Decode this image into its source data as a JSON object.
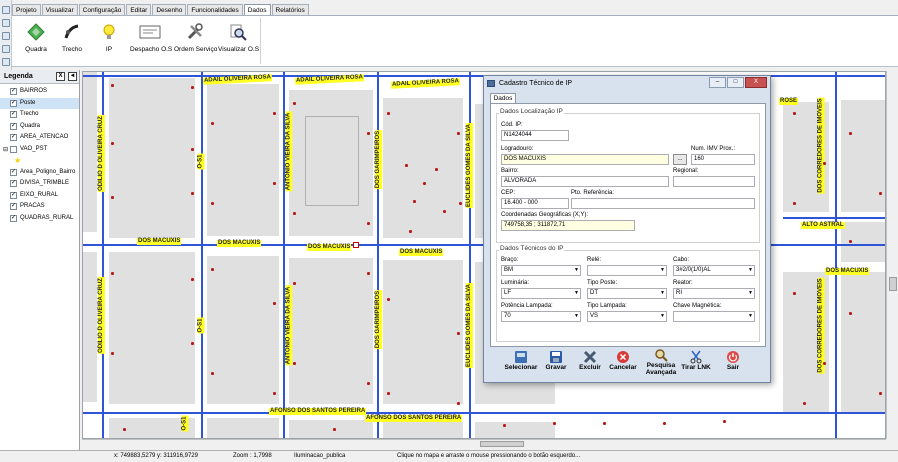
{
  "tabs": [
    "Projeto",
    "Visualizar",
    "Configuração",
    "Editar",
    "Desenho",
    "Funcionalidades",
    "Dados",
    "Relatórios"
  ],
  "active_tab": "Dados",
  "ribbon": {
    "quadra": "Quadra",
    "trecho": "Trecho",
    "ip": "IP",
    "despacho": "Despacho O.S",
    "ordem": "Ordem Serviço",
    "visualizar": "Visualizar O.S"
  },
  "legend": {
    "title": "Legenda",
    "close": "X",
    "pin": "◄",
    "items": [
      {
        "label": "BAIRROS",
        "checked": true
      },
      {
        "label": "Poste",
        "checked": true
      },
      {
        "label": "Trecho",
        "checked": true
      },
      {
        "label": "Quadra",
        "checked": true
      },
      {
        "label": "AREA_ATENCAO",
        "checked": true
      },
      {
        "label": "VAO_PST",
        "checked": false
      },
      {
        "label": "Area_Poligno_Bairro",
        "checked": true
      },
      {
        "label": "DIVISA_TRIMBLE",
        "checked": true
      },
      {
        "label": "EIXO_RURAL",
        "checked": true
      },
      {
        "label": "PRACAS",
        "checked": true
      },
      {
        "label": "QUADRAS_RURAL",
        "checked": true
      }
    ]
  },
  "map": {
    "streets": {
      "adail1": "ADAIL OLIVEIRA ROSA",
      "adail2": "ADAIL OLIVEIRA ROSA",
      "adail3": "ADAIL OLIVEIRA ROSA",
      "macuxis1": "DOS MACUXIS",
      "macuxis2": "DOS MACUXIS",
      "macuxis3": "DOS MACUXIS",
      "macuxis4": "DOS MACUXIS",
      "macuxis5": "DOS MACUXIS",
      "afonso1": "AFONSO DOS SANTOS PEREIRA",
      "afonso2": "AFONSO DOS SANTOS PEREIRA",
      "odilio1": "ODILIO D OLIVEIRA CRUZ",
      "odilio2": "ODILIO D OLIVEIRA CRUZ",
      "s1a": "O-S1",
      "s1b": "O-S1",
      "s1c": "O-S1",
      "antonio1": "ANTONIO VIEIRA DA SILVA",
      "antonio2": "ANTONIO VIEIRA DA SILVA",
      "garim1": "DOS GARIMPEIROS",
      "garim2": "DOS GARIMPEIROS",
      "euc1": "EUCLIDES GOMES DA SILVA",
      "euc2": "EUCLIDES GOMES DA SILVA",
      "corr1": "DOS CORREDORES DE IMOVEIS",
      "corr2": "DOS CORREDORES DE IMOVEIS",
      "alto": "ALTO ASTRAL",
      "rose": "ROSE"
    }
  },
  "status": {
    "coords": "x: 749883,5279 y: 311916,9729",
    "zoom": "Zoom : 1,7998",
    "layer": "Iluminacao_publica",
    "hint": "Clique no mapa e arraste o mouse pressionando o botão esquerdo..."
  },
  "dialog": {
    "title": "Cadastro Técnico de IP",
    "minimize": "–",
    "maximize": "□",
    "close": "X",
    "tab": "Dados",
    "loc_group": "Dados Localização IP",
    "cod_ip_label": "Cód. IP:",
    "cod_ip": "N1424044",
    "logradouro_label": "Logradouro:",
    "logradouro": "DOS MACUXIS",
    "browse": "...",
    "num_label": "Num. IMV Prox.:",
    "num": "160",
    "bairro_label": "Bairro:",
    "bairro": "ALVORADA",
    "regional_label": "Regional:",
    "regional": "",
    "cep_label": "CEP:",
    "cep": "16.400 - 000",
    "ref_label": "Pto. Referência:",
    "ref": "",
    "coord_label": "Coordenadas Geográficas (X;Y):",
    "coord": "749758,35 ; 311872,71",
    "tec_group": "Dados Técnicos do IP",
    "braco_label": "Braço:",
    "braco": "BM",
    "rele_label": "Relé:",
    "rele": "",
    "cabo_label": "Cabo:",
    "cabo": "3#2/0(1/0)AL",
    "luminaria_label": "Luminária:",
    "luminaria": "LF",
    "tipo_poste_label": "Tipo Poste:",
    "tipo_poste": "DT",
    "reator_label": "Reator:",
    "reator": "RI",
    "potencia_label": "Potência Lampada:",
    "potencia": "70",
    "tipo_lampada_label": "Tipo Lampada:",
    "tipo_lampada": "VS",
    "chave_label": "Chave Magnética:",
    "chave": "",
    "toolbar": {
      "selecionar": "Selecionar",
      "gravar": "Gravar",
      "excluir": "Excluir",
      "cancelar": "Cancelar",
      "pesquisa1": "Pesquisa",
      "pesquisa2": "Avançada",
      "tirar": "Tirar LNK",
      "sair": "Sair"
    }
  }
}
